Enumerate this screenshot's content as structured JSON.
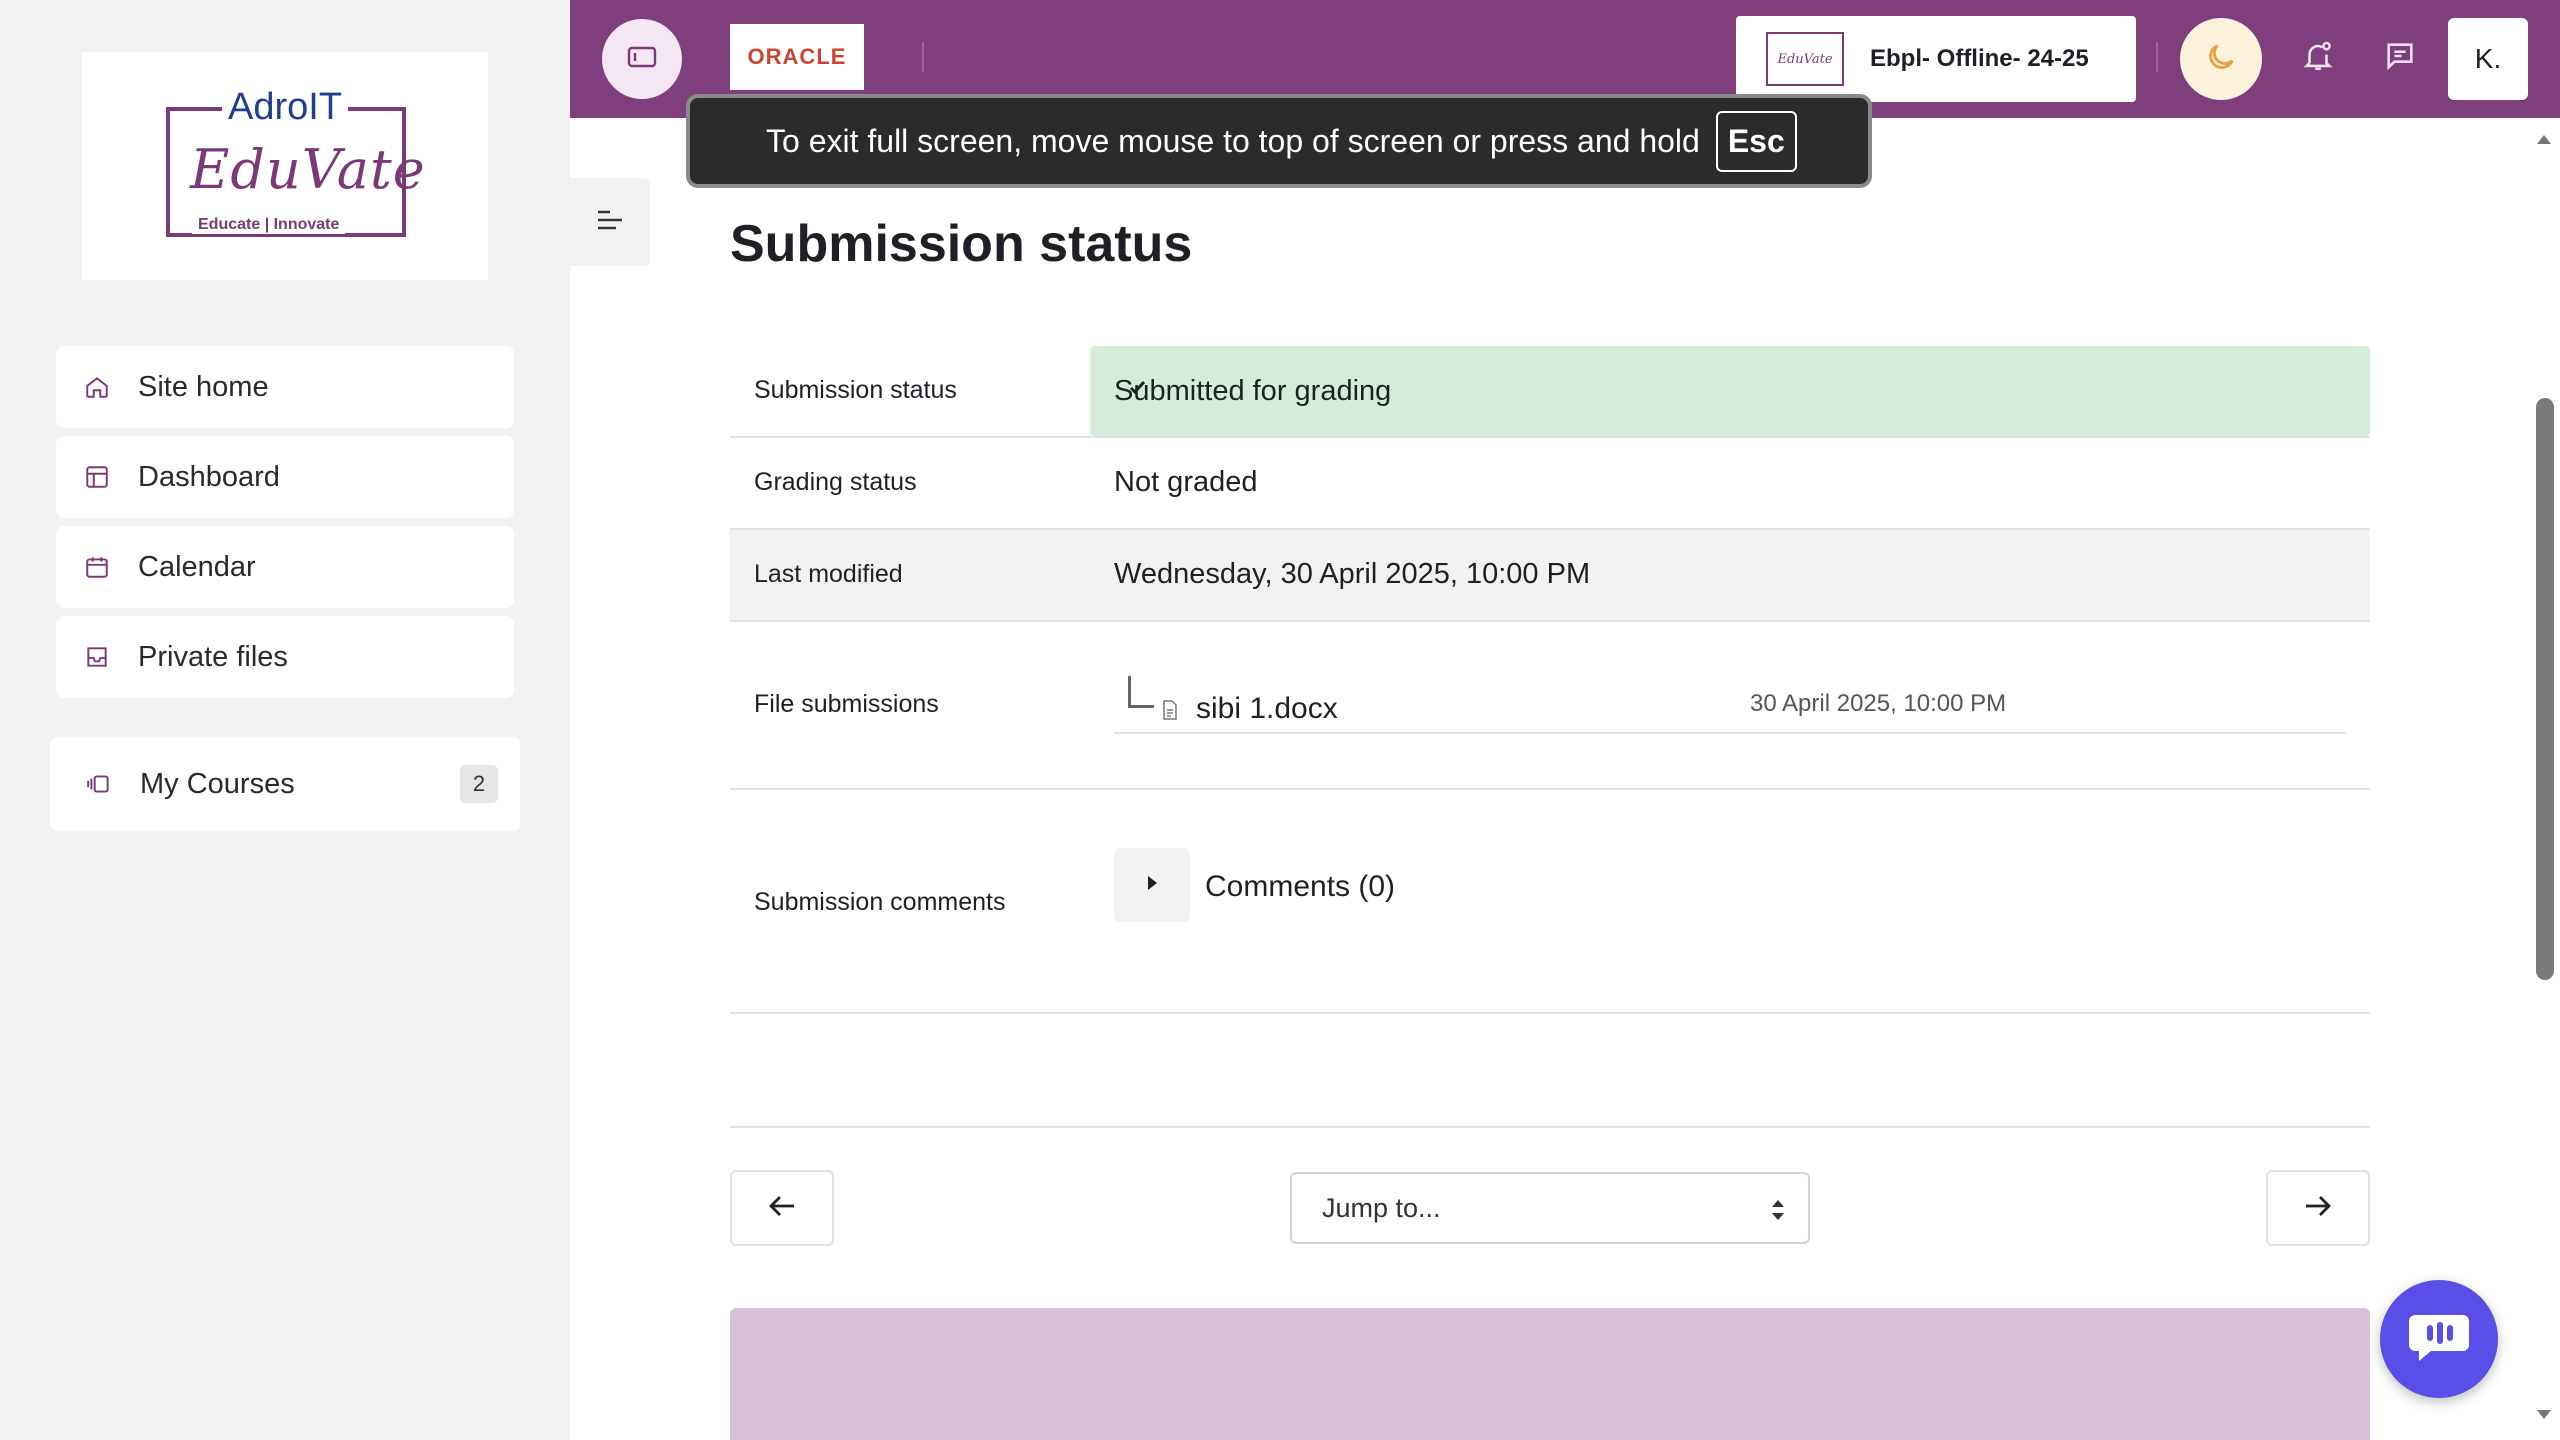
{
  "logo": {
    "top_text": "AdroIT",
    "main_text": "EduVate",
    "sub_text": "Educate | Innovate"
  },
  "sidebar": {
    "items": [
      {
        "label": "Site home",
        "icon": "home-icon"
      },
      {
        "label": "Dashboard",
        "icon": "dashboard-icon"
      },
      {
        "label": "Calendar",
        "icon": "calendar-icon"
      },
      {
        "label": "Private files",
        "icon": "inbox-icon"
      }
    ],
    "my_courses": {
      "label": "My Courses",
      "count": "2",
      "icon": "courses-icon"
    }
  },
  "header": {
    "oracle_label": "ORACLE",
    "org_logo_text": "EduVate",
    "org_name": "Ebpl- Offline- 24-25",
    "avatar_initial": "K."
  },
  "fullscreen_toast": {
    "message": "To exit full screen, move mouse to top of screen or press and hold",
    "key": "Esc"
  },
  "main": {
    "title": "Submission status",
    "rows": {
      "submission_status": {
        "label": "Submission status",
        "value": "Submitted for grading"
      },
      "grading_status": {
        "label": "Grading status",
        "value": "Not graded"
      },
      "last_modified": {
        "label": "Last modified",
        "value": "Wednesday, 30 April 2025, 10:00 PM"
      },
      "file_submissions": {
        "label": "File submissions",
        "file_name": "sibi 1.docx",
        "file_date": "30 April 2025, 10:00 PM"
      },
      "submission_comments": {
        "label": "Submission comments",
        "comments_label": "Comments (0)"
      }
    },
    "jump_to": {
      "selected": "Jump to..."
    }
  },
  "colors": {
    "topbar": "#7f3f7c",
    "status_green": "#d4edda",
    "brand_purple": "#7a3a78",
    "chat_fab": "#5a4ee8"
  }
}
